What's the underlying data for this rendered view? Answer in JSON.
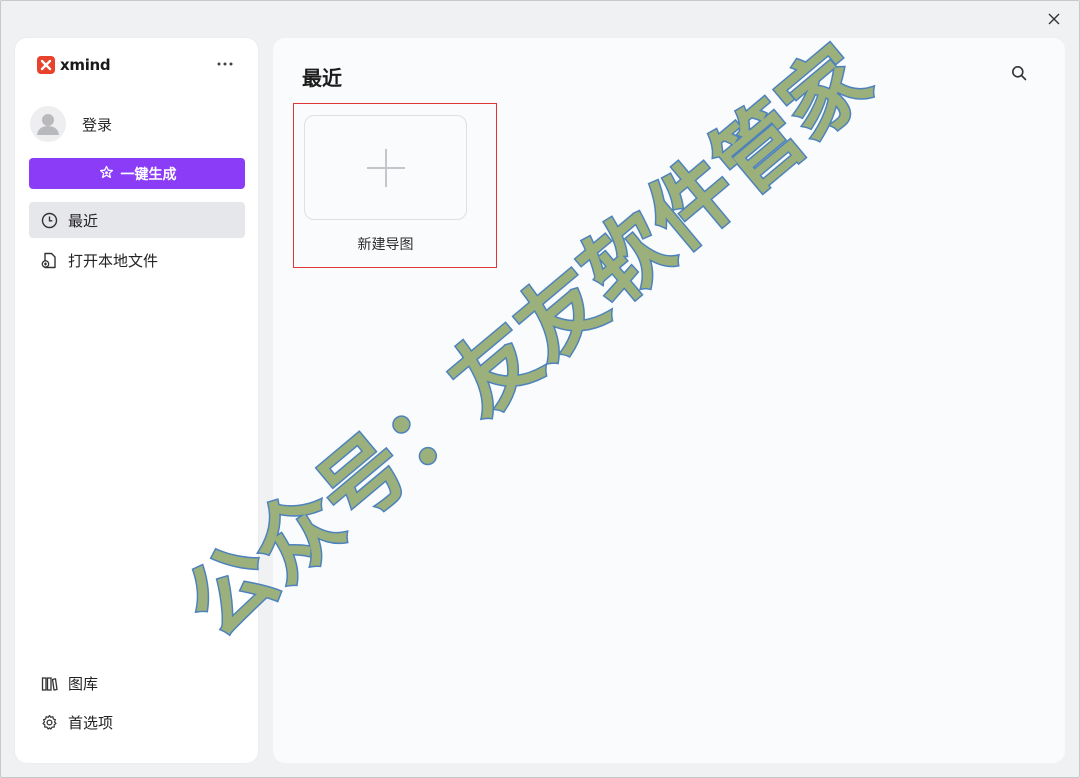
{
  "window": {
    "close_icon": "close-icon"
  },
  "sidebar": {
    "brand_name": "xmind",
    "more_icon": "more-horizontal-icon",
    "user_label": "登录",
    "generate_label": "一键生成",
    "nav": [
      {
        "label": "最近",
        "icon": "clock-icon",
        "active": true
      },
      {
        "label": "打开本地文件",
        "icon": "open-file-icon",
        "active": false
      }
    ],
    "bottom": [
      {
        "label": "图库",
        "icon": "library-icon"
      },
      {
        "label": "首选项",
        "icon": "gear-icon"
      }
    ]
  },
  "main": {
    "title": "最近",
    "search_icon": "search-icon",
    "new_card_label": "新建导图"
  },
  "colors": {
    "accent": "#8b3cf7",
    "brand": "#e8412c",
    "highlight": "#e0363a",
    "watermark_fill": "#9bb07a",
    "watermark_stroke": "#4d82bd"
  },
  "watermark": {
    "text": "公众号：友友软件管家"
  }
}
